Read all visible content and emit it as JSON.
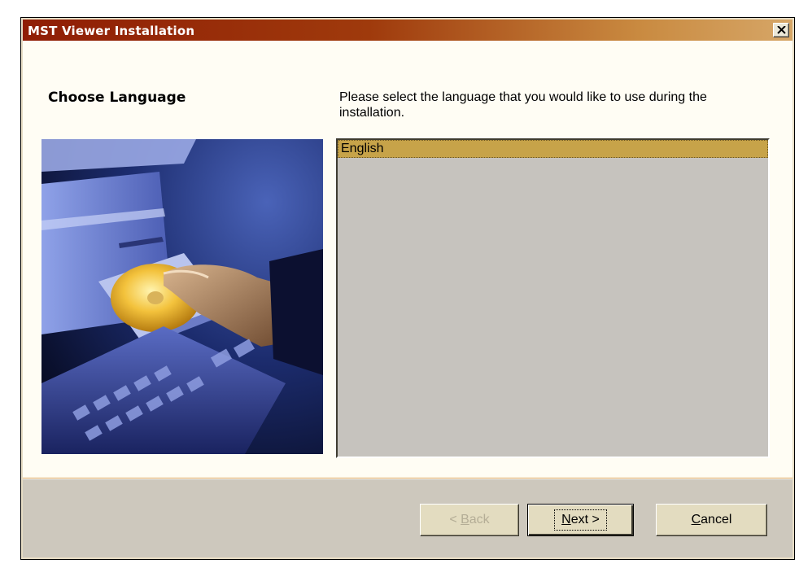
{
  "window": {
    "title": "MST Viewer Installation",
    "close_label": "Close"
  },
  "page": {
    "heading": "Choose Language",
    "prompt": "Please select the language that you would like to use during the installation."
  },
  "language_list": {
    "items": [
      {
        "label": "English",
        "selected": true
      }
    ]
  },
  "buttons": {
    "back": {
      "label": "< Back",
      "mnemonic": "B",
      "enabled": false
    },
    "next": {
      "label": "Next >",
      "mnemonic": "N",
      "enabled": true,
      "default": true
    },
    "cancel": {
      "label": "Cancel",
      "mnemonic": "C",
      "enabled": true
    }
  },
  "colors": {
    "titlebar_start": "#8f1d05",
    "titlebar_end": "#d6a667",
    "selection": "#c7a349",
    "dialog_bg": "#fffdf4",
    "footer_bg": "#cdc8bd"
  }
}
